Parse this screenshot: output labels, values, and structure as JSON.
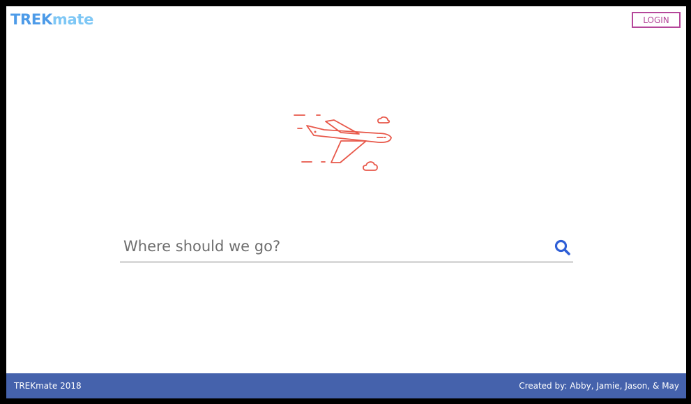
{
  "header": {
    "logo_part1": "TREK",
    "logo_part2": "mate",
    "login_label": "LOGIN"
  },
  "hero": {
    "illustration_icon": "airplane-icon",
    "accent_color": "#e8584a"
  },
  "search": {
    "placeholder": "Where should we go?",
    "value": "",
    "icon": "search-icon",
    "icon_color": "#2f5fd6"
  },
  "footer": {
    "left_text": "TREKmate 2018",
    "right_text": "Created by: Abby, Jamie, Jason, & May",
    "background_color": "#4562ac"
  },
  "colors": {
    "logo_primary": "#4d9be8",
    "logo_secondary": "#7ec7f5",
    "login_border": "#b5479a"
  }
}
